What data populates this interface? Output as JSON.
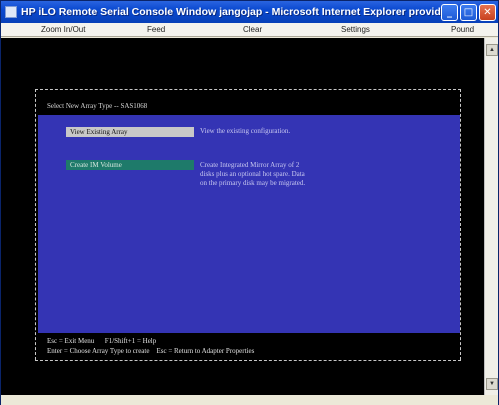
{
  "window": {
    "title": "HP iLO Remote Serial Console Window jangojap - Microsoft Internet Explorer provided ...",
    "min_glyph": "_",
    "max_glyph": "□",
    "close_glyph": "✕"
  },
  "menubar": {
    "items": [
      "Zoom In/Out",
      "Feed",
      "Clear",
      "Settings",
      "Pound"
    ]
  },
  "console": {
    "header": "Select New Array Type -- SAS1068",
    "options": [
      {
        "label": "View Existing Array",
        "description": [
          "View the existing configuration."
        ]
      },
      {
        "label": "Create IM Volume",
        "description": [
          "Create Integrated Mirror Array of 2",
          "disks plus an optional hot spare. Data",
          "on the primary disk may be migrated."
        ]
      }
    ],
    "footer_line1": "Esc = Exit Menu      F1/Shift+1 = Help",
    "footer_line2": "Enter = Choose Array Type to create    Esc = Return to Adapter Properties"
  }
}
